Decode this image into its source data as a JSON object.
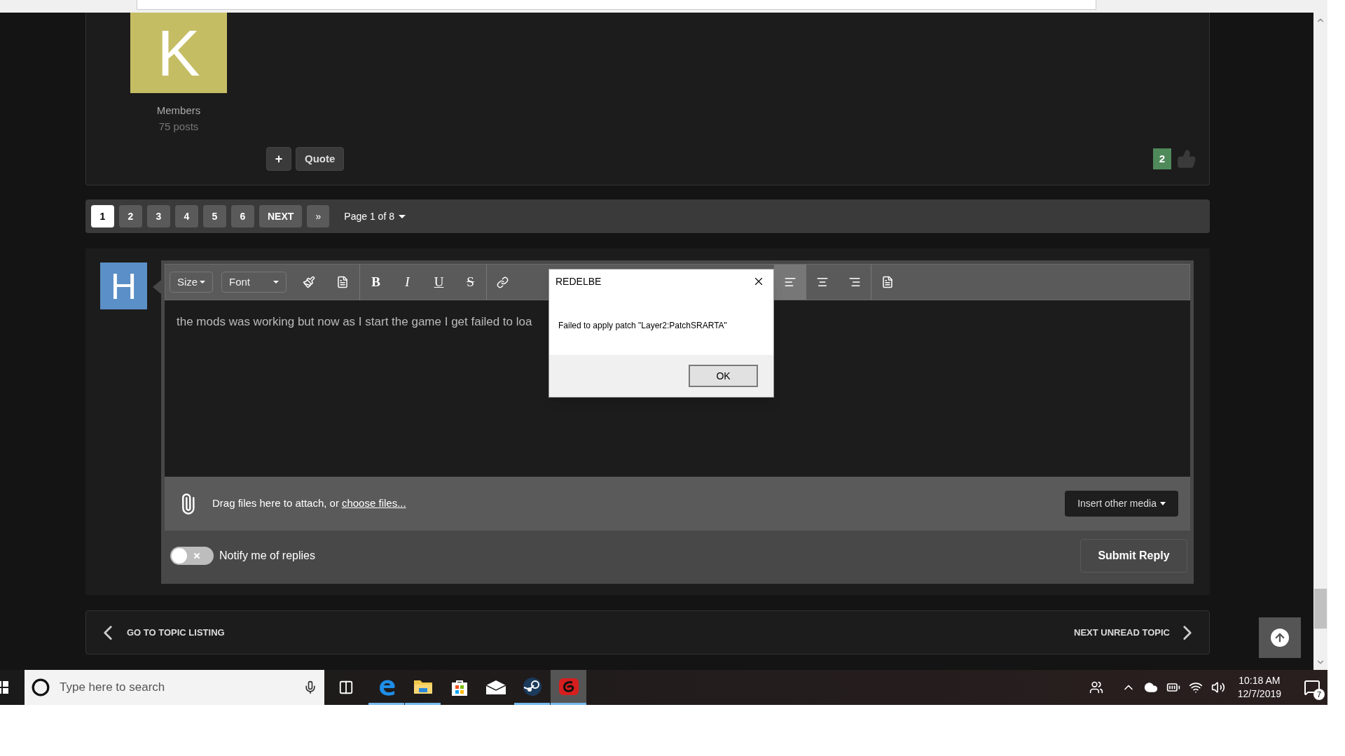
{
  "post": {
    "avatar_letter": "K",
    "group": "Members",
    "post_count": "75 posts",
    "add_button": "+",
    "quote_button": "Quote",
    "reputation": "2"
  },
  "pagination": {
    "pages": [
      {
        "label": "1",
        "selected": true
      },
      {
        "label": "2",
        "selected": false
      },
      {
        "label": "3",
        "selected": false
      },
      {
        "label": "4",
        "selected": false
      },
      {
        "label": "5",
        "selected": false
      },
      {
        "label": "6",
        "selected": false
      }
    ],
    "next": "NEXT",
    "last": "»",
    "page_menu": "Page 1 of 8"
  },
  "reply": {
    "avatar_letter": "H",
    "toolbar": {
      "size": "Size",
      "font": "Font",
      "format": [
        {
          "kind": "bold",
          "label": "B"
        },
        {
          "kind": "italic",
          "label": "I"
        },
        {
          "kind": "underline",
          "label": "U"
        },
        {
          "kind": "strike",
          "label": "S"
        }
      ],
      "align": [
        {
          "kind": "left",
          "selected": true
        },
        {
          "kind": "center",
          "selected": false
        },
        {
          "kind": "right",
          "selected": false
        }
      ]
    },
    "text": "the mods was working but now as I start the game I get failed to loa",
    "attach_text": "Drag files here to attach, or",
    "attach_link": "choose files...",
    "insert_media": "Insert other media",
    "notify": {
      "label": "Notify me of replies",
      "on": false
    },
    "submit": "Submit Reply"
  },
  "topic_nav": {
    "previous": "GO TO TOPIC LISTING",
    "next": "NEXT UNREAD TOPIC"
  },
  "dialog": {
    "title": "REDELBE",
    "message": "Failed to apply patch \"Layer2:PatchSRARTA\"",
    "button": "OK"
  },
  "taskbar": {
    "search_placeholder": "Type here to search",
    "apps": [
      {
        "kind": "edge",
        "running": true,
        "active": false
      },
      {
        "kind": "explorer",
        "running": true,
        "active": false
      },
      {
        "kind": "store",
        "running": false,
        "active": false
      },
      {
        "kind": "mail",
        "running": false,
        "active": false
      },
      {
        "kind": "steam",
        "running": true,
        "active": false
      },
      {
        "kind": "game",
        "running": true,
        "active": true
      }
    ],
    "time": "10:18 AM",
    "date": "12/7/2019",
    "notifications": "7"
  }
}
